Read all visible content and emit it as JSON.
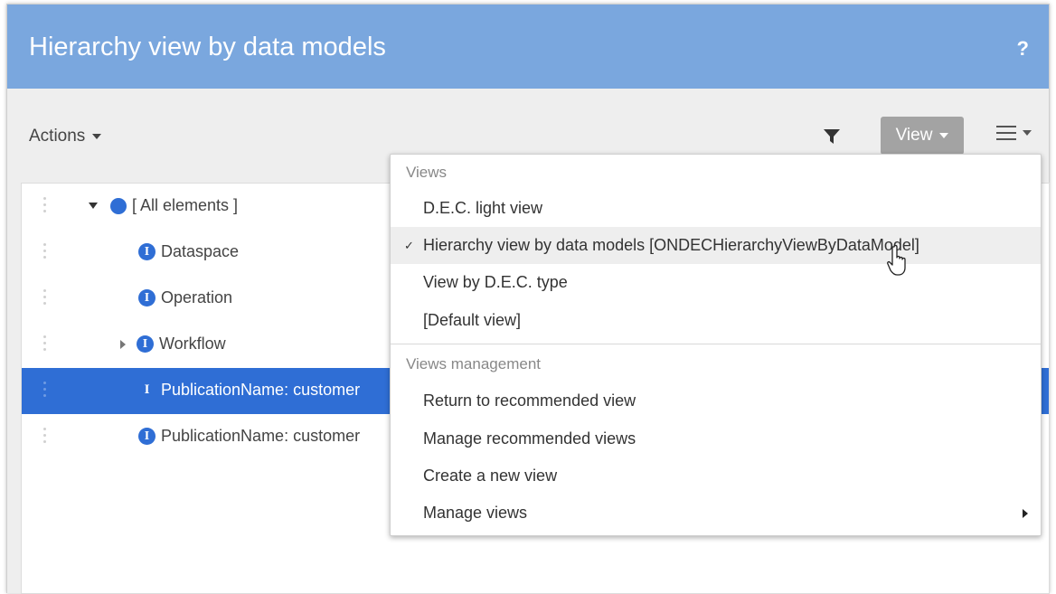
{
  "header": {
    "title": "Hierarchy view by data models",
    "help_label": "?"
  },
  "toolbar": {
    "actions_label": "Actions",
    "view_label": "View",
    "filter_icon": "filter-icon",
    "options_icon": "hamburger-menu-icon"
  },
  "tree": {
    "rows": [
      {
        "label": "[ All elements ]",
        "icon": "dot-icon",
        "expander": "expanded",
        "selected": false
      },
      {
        "label": "Dataspace",
        "icon": "info-icon",
        "expander": "none",
        "selected": false
      },
      {
        "label": "Operation",
        "icon": "info-icon",
        "expander": "none",
        "selected": false
      },
      {
        "label": "Workflow",
        "icon": "info-icon",
        "expander": "collapsed",
        "selected": false
      },
      {
        "label": "PublicationName: customer",
        "icon": "info-icon",
        "expander": "none",
        "selected": true
      },
      {
        "label": "PublicationName: customer",
        "icon": "info-icon",
        "expander": "none",
        "selected": false
      }
    ]
  },
  "view_menu": {
    "views_title": "Views",
    "views": [
      {
        "label": "D.E.C. light view",
        "checked": false
      },
      {
        "label": "Hierarchy view by data models [ONDECHierarchyViewByDataModel]",
        "checked": true
      },
      {
        "label": "View by D.E.C. type",
        "checked": false
      },
      {
        "label": "[Default view]",
        "checked": false
      }
    ],
    "check_mark": "✓",
    "management_title": "Views management",
    "management": [
      {
        "label": "Return to recommended view"
      },
      {
        "label": "Manage recommended views"
      },
      {
        "label": "Create a new view"
      },
      {
        "label": "Manage views",
        "has_submenu": true
      }
    ]
  },
  "colors": {
    "header_bg": "#7aa7de",
    "accent": "#2f6ed5",
    "view_button_bg": "#a3a3a3",
    "page_bg": "#eeeeee"
  }
}
